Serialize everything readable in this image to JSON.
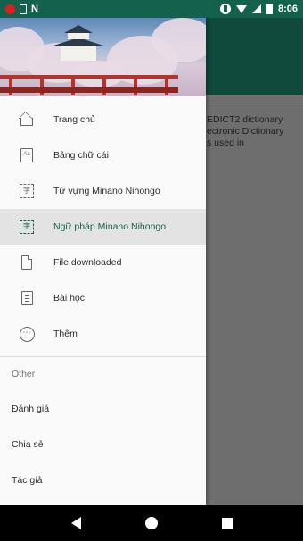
{
  "status_bar": {
    "time": "8:06",
    "left_icons": [
      "record-icon",
      "sim-icon",
      "n-icon"
    ],
    "right_icons": [
      "vibrate-icon",
      "wifi-icon",
      "signal-icon",
      "battery-icon"
    ]
  },
  "background": {
    "text_lines": [
      "EDICT2 dictionary",
      "ectronic Dictionary",
      "s used in"
    ]
  },
  "drawer": {
    "items": [
      {
        "label": "Trang chủ",
        "icon": "home-icon"
      },
      {
        "label": "Bảng chữ cái",
        "icon": "alphabet-book-icon",
        "icon_text": "Aa"
      },
      {
        "label": "Từ vựng Minano Nihongo",
        "icon": "vocabulary-icon",
        "icon_text": "字"
      },
      {
        "label": "Ngữ pháp Minano Nihongo",
        "icon": "grammar-icon",
        "icon_text": "字",
        "active": true
      },
      {
        "label": "File downloaded",
        "icon": "file-icon"
      },
      {
        "label": "Bài học",
        "icon": "lesson-icon"
      },
      {
        "label": "Thêm",
        "icon": "more-icon",
        "icon_text": "⋯"
      }
    ],
    "section_label": "Other",
    "other_items": [
      "Đánh giá",
      "Chia sẻ",
      "Tác giả"
    ]
  },
  "colors": {
    "primary": "#14614e",
    "status_bar": "#14614e",
    "active_text": "#14614e",
    "scrim": "#6e6e6e"
  },
  "nav_bar": {
    "buttons": [
      "back-icon",
      "home-icon",
      "recents-icon"
    ]
  }
}
